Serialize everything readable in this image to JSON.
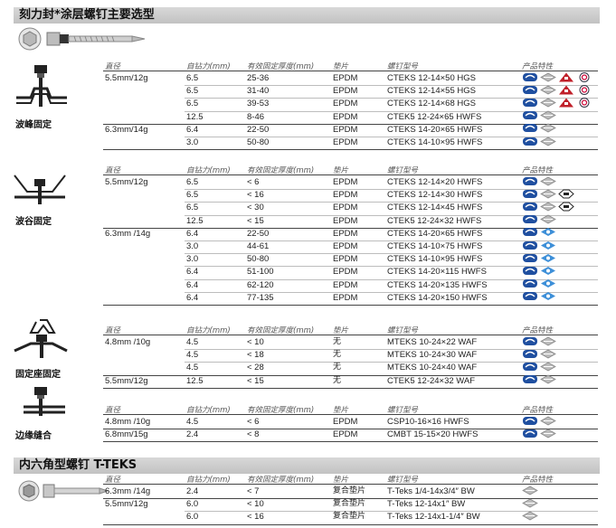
{
  "title": "刻力封*涂层螺钉主要选型",
  "title2": "内六角型螺钉 T-TEKS",
  "headers": {
    "dia": "直径",
    "drill": "自钻力(mm)",
    "thick": "有效固定厚度(mm)",
    "pad": "垫片",
    "model": "螺钉型号",
    "feature": "产品特性"
  },
  "sections": [
    {
      "label": "波峰固定",
      "groups": [
        {
          "dia": "5.5mm/12g",
          "rows": [
            {
              "drill": "6.5",
              "thick": "25-36",
              "pad": "EPDM",
              "model": "CTEKS 12-14×50 HGS",
              "icons": [
                "cw",
                "ar",
                "tri",
                "c"
              ]
            },
            {
              "drill": "6.5",
              "thick": "31-40",
              "pad": "EPDM",
              "model": "CTEKS 12-14×55 HGS",
              "icons": [
                "cw",
                "ar",
                "tri",
                "c"
              ]
            },
            {
              "drill": "6.5",
              "thick": "39-53",
              "pad": "EPDM",
              "model": "CTEKS 12-14×68 HGS",
              "icons": [
                "cw",
                "ar",
                "tri",
                "c"
              ]
            },
            {
              "drill": "12.5",
              "thick": "8-46",
              "pad": "EPDM",
              "model": "CTEK5 12-24×65 HWFS",
              "icons": [
                "cw",
                "ar"
              ]
            }
          ]
        },
        {
          "dia": "6.3mm/14g",
          "rows": [
            {
              "drill": "6.4",
              "thick": "22-50",
              "pad": "EPDM",
              "model": "CTEKS 14-20×65 HWFS",
              "icons": [
                "cw",
                "ar"
              ]
            },
            {
              "drill": "3.0",
              "thick": "50-80",
              "pad": "EPDM",
              "model": "CTEKS 14-10×95 HWFS",
              "icons": [
                "cw",
                "ar"
              ]
            }
          ]
        }
      ]
    },
    {
      "label": "波谷固定",
      "groups": [
        {
          "dia": "5.5mm/12g",
          "rows": [
            {
              "drill": "6.5",
              "thick": "< 6",
              "pad": "EPDM",
              "model": "CTEKS 12-14×20 HWFS",
              "icons": [
                "cw",
                "ar"
              ]
            },
            {
              "drill": "6.5",
              "thick": "< 16",
              "pad": "EPDM",
              "model": "CTEKS 12-14×30 HWFS",
              "icons": [
                "cw",
                "ar",
                "fm"
              ]
            },
            {
              "drill": "6.5",
              "thick": "< 30",
              "pad": "EPDM",
              "model": "CTEKS 12-14×45 HWFS",
              "icons": [
                "cw",
                "ar",
                "fm"
              ]
            },
            {
              "drill": "12.5",
              "thick": "< 15",
              "pad": "EPDM",
              "model": "CTEK5 12-24×32 HWFS",
              "icons": [
                "cw",
                "ar"
              ]
            }
          ]
        },
        {
          "dia": "6.3mm /14g",
          "rows": [
            {
              "drill": "6.4",
              "thick": "22-50",
              "pad": "EPDM",
              "model": "CTEKS 14-20×65 HWFS",
              "icons": [
                "cw",
                "bl"
              ]
            },
            {
              "drill": "3.0",
              "thick": "44-61",
              "pad": "EPDM",
              "model": "CTEKS 14-10×75 HWFS",
              "icons": [
                "cw",
                "bl"
              ]
            },
            {
              "drill": "3.0",
              "thick": "50-80",
              "pad": "EPDM",
              "model": "CTEKS 14-10×95 HWFS",
              "icons": [
                "cw",
                "bl"
              ]
            },
            {
              "drill": "6.4",
              "thick": "51-100",
              "pad": "EPDM",
              "model": "CTEKS 14-20×115 HWFS",
              "icons": [
                "cw",
                "bl"
              ]
            },
            {
              "drill": "6.4",
              "thick": "62-120",
              "pad": "EPDM",
              "model": "CTEKS 14-20×135 HWFS",
              "icons": [
                "cw",
                "bl"
              ]
            },
            {
              "drill": "6.4",
              "thick": "77-135",
              "pad": "EPDM",
              "model": "CTEKS 14-20×150 HWFS",
              "icons": [
                "cw",
                "bl"
              ]
            }
          ]
        }
      ]
    },
    {
      "label": "固定座固定",
      "groups": [
        {
          "dia": "4.8mm /10g",
          "rows": [
            {
              "drill": "4.5",
              "thick": "< 10",
              "pad": "无",
              "model": "MTEKS 10-24×22 WAF",
              "icons": [
                "cw",
                "ar"
              ]
            },
            {
              "drill": "4.5",
              "thick": "< 18",
              "pad": "无",
              "model": "MTEKS 10-24×30 WAF",
              "icons": [
                "cw",
                "ar"
              ]
            },
            {
              "drill": "4.5",
              "thick": "< 28",
              "pad": "无",
              "model": "MTEKS 10-24×40 WAF",
              "icons": [
                "cw",
                "ar"
              ]
            }
          ]
        },
        {
          "dia": "5.5mm/12g",
          "rows": [
            {
              "drill": "12.5",
              "thick": "< 15",
              "pad": "无",
              "model": "CTEK5 12-24×32 WAF",
              "icons": [
                "cw",
                "ar"
              ]
            }
          ]
        }
      ]
    },
    {
      "label": "边缘缝合",
      "groups": [
        {
          "dia": "4.8mm /10g",
          "rows": [
            {
              "drill": "4.5",
              "thick": "< 6",
              "pad": "EPDM",
              "model": "CSP10-16×16 HWFS",
              "icons": [
                "cw",
                "ar"
              ]
            }
          ]
        },
        {
          "dia": "6.8mm/15g",
          "rows": [
            {
              "drill": "2.4",
              "thick": "< 8",
              "pad": "EPDM",
              "model": "CMBT 15-15×20 HWFS",
              "icons": [
                "cw",
                "ar"
              ]
            }
          ]
        }
      ]
    },
    {
      "label": "",
      "groups": [
        {
          "dia": "6.3mm /14g",
          "rows": [
            {
              "drill": "2.4",
              "thick": "< 7",
              "pad": "复合垫片",
              "model": "T-Teks 1/4-14x3/4″ BW",
              "icons": [
                "ar"
              ]
            }
          ]
        },
        {
          "dia": "5.5mm/12g",
          "rows": [
            {
              "drill": "6.0",
              "thick": "< 10",
              "pad": "复合垫片",
              "model": "T-Teks 12-14x1″ BW",
              "icons": [
                "ar"
              ]
            },
            {
              "drill": "6.0",
              "thick": "< 16",
              "pad": "复合垫片",
              "model": "T-Teks 12-14x1-1/4″ BW",
              "icons": [
                "ar"
              ]
            }
          ]
        }
      ]
    }
  ],
  "colors": {
    "band": "#c8c8c8",
    "cw": "#1f4fa0",
    "c2": "#3d8fd8",
    "tri": "#c0202a"
  }
}
